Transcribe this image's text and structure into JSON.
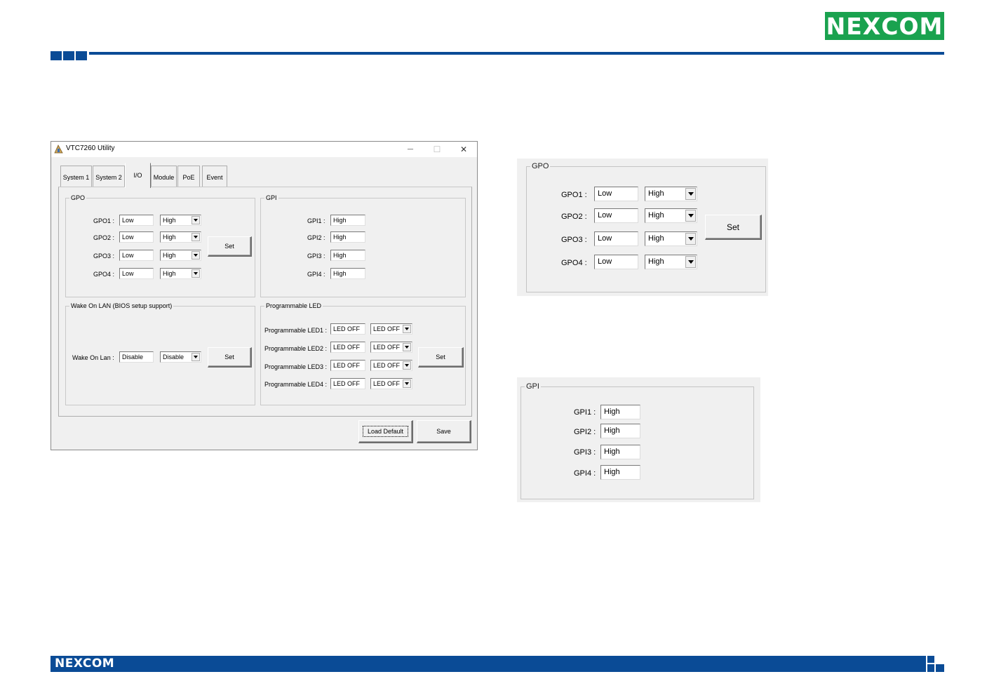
{
  "brand": {
    "logo_text_left": "NE",
    "logo_text_x": "X",
    "logo_text_right": "COM",
    "color": "#1aa24f",
    "accent": "#0a4b96"
  },
  "footer": {
    "logo_text": "NEXCOM"
  },
  "window": {
    "title": "VTC7260 Utility",
    "controls": {
      "minimize": "—",
      "maximize": "☐",
      "close": "✕"
    },
    "tabs": [
      {
        "label": "System 1"
      },
      {
        "label": "System 2"
      },
      {
        "label": "I/O"
      },
      {
        "label": "Module"
      },
      {
        "label": "PoE"
      },
      {
        "label": "Event"
      }
    ],
    "gpo": {
      "title": "GPO",
      "rows": [
        {
          "label": "GPO1 :",
          "value": "Low",
          "select": "High"
        },
        {
          "label": "GPO2 :",
          "value": "Low",
          "select": "High"
        },
        {
          "label": "GPO3 :",
          "value": "Low",
          "select": "High"
        },
        {
          "label": "GPO4 :",
          "value": "Low",
          "select": "High"
        }
      ],
      "set_label": "Set"
    },
    "gpi": {
      "title": "GPI",
      "rows": [
        {
          "label": "GPI1 :",
          "value": "High"
        },
        {
          "label": "GPI2 :",
          "value": "High"
        },
        {
          "label": "GPI3 :",
          "value": "High"
        },
        {
          "label": "GPI4 :",
          "value": "High"
        }
      ]
    },
    "wol": {
      "title": "Wake On LAN (BIOS setup support)",
      "label": "Wake On Lan :",
      "value": "Disable",
      "select": "Disable",
      "set_label": "Set"
    },
    "pled": {
      "title": "Programmable LED",
      "rows": [
        {
          "label": "Programmable LED1 :",
          "value": "LED OFF",
          "select": "LED OFF"
        },
        {
          "label": "Programmable LED2 :",
          "value": "LED OFF",
          "select": "LED OFF"
        },
        {
          "label": "Programmable LED3 :",
          "value": "LED OFF",
          "select": "LED OFF"
        },
        {
          "label": "Programmable LED4 :",
          "value": "LED OFF",
          "select": "LED OFF"
        }
      ],
      "set_label": "Set"
    },
    "load_default_label": "Load Default",
    "save_label": "Save"
  },
  "zoom_gpo": {
    "title": "GPO",
    "rows": [
      {
        "label": "GPO1 :",
        "value": "Low",
        "select": "High"
      },
      {
        "label": "GPO2 :",
        "value": "Low",
        "select": "High"
      },
      {
        "label": "GPO3 :",
        "value": "Low",
        "select": "High"
      },
      {
        "label": "GPO4 :",
        "value": "Low",
        "select": "High"
      }
    ],
    "set_label": "Set"
  },
  "zoom_gpi": {
    "title": "GPI",
    "rows": [
      {
        "label": "GPI1 :",
        "value": "High"
      },
      {
        "label": "GPI2 :",
        "value": "High"
      },
      {
        "label": "GPI3 :",
        "value": "High"
      },
      {
        "label": "GPI4 :",
        "value": "High"
      }
    ]
  }
}
